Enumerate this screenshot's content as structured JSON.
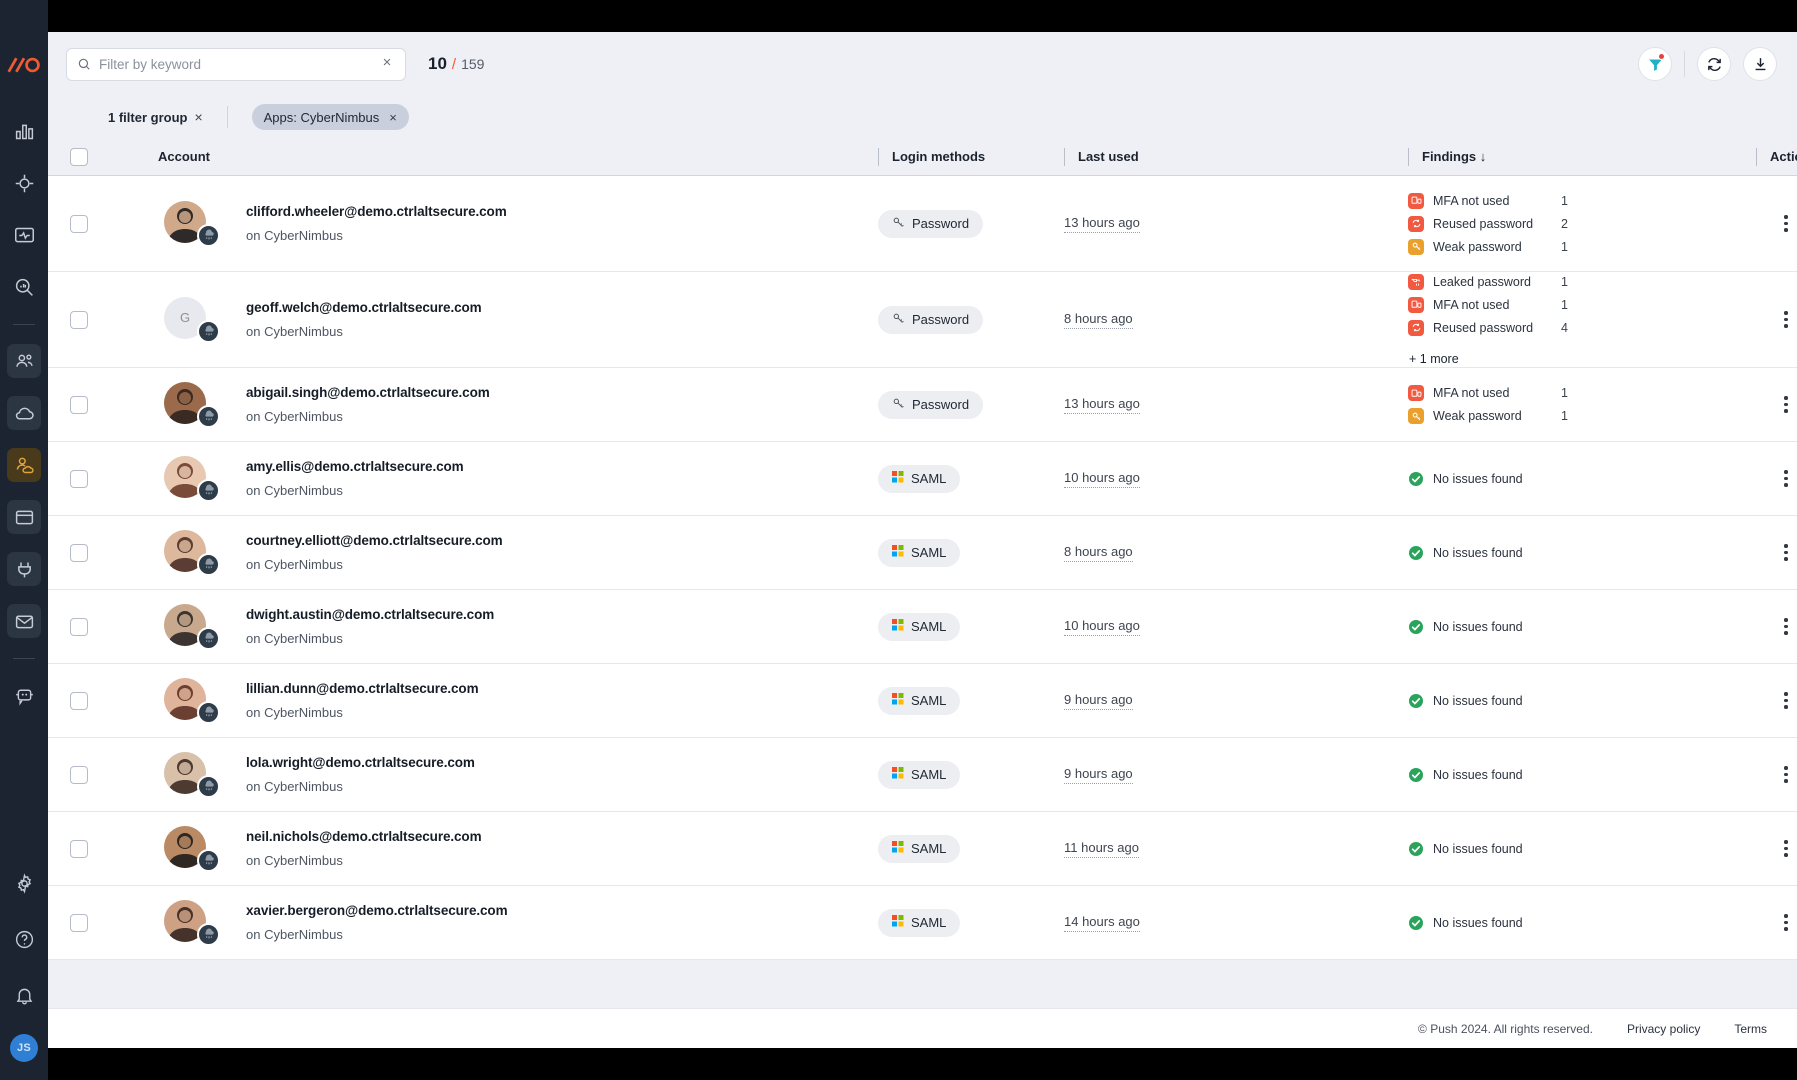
{
  "brand": {
    "logo": "push-logo-icon",
    "accent": "#ef5a33"
  },
  "sidebar": {
    "items": [
      {
        "name": "dashboard",
        "icon": "bar-chart-icon",
        "state": "default"
      },
      {
        "name": "targets",
        "icon": "crosshair-icon",
        "state": "default"
      },
      {
        "name": "activity",
        "icon": "monitor-pulse-icon",
        "state": "default"
      },
      {
        "name": "search",
        "icon": "magnifier-chart-icon",
        "state": "default"
      },
      {
        "name": "identities",
        "icon": "people-icon",
        "state": "active-dark"
      },
      {
        "name": "apps",
        "icon": "cloud-icon",
        "state": "active-dark"
      },
      {
        "name": "accounts",
        "icon": "person-cloud-icon",
        "state": "active-gold"
      },
      {
        "name": "browsers",
        "icon": "window-icon",
        "state": "active-dark"
      },
      {
        "name": "extensions",
        "icon": "plug-icon",
        "state": "active-dark"
      },
      {
        "name": "email",
        "icon": "envelope-icon",
        "state": "active-dark"
      },
      {
        "name": "chatbot",
        "icon": "chat-bot-icon",
        "state": "default"
      }
    ],
    "bottom": [
      {
        "name": "settings",
        "icon": "gear-icon"
      },
      {
        "name": "help",
        "icon": "question-circle-icon"
      },
      {
        "name": "notifications",
        "icon": "bell-icon"
      }
    ],
    "user_initials": "JS"
  },
  "search": {
    "placeholder": "Filter by keyword",
    "value": "",
    "icon": "search-icon",
    "clear_icon": "×"
  },
  "count": {
    "current": "10",
    "separator": "/",
    "total": "159"
  },
  "topbar_actions": [
    {
      "name": "filter-button",
      "icon": "funnel-icon",
      "badge": true
    },
    {
      "name": "refresh-button",
      "icon": "refresh-icon",
      "badge": false
    },
    {
      "name": "download-button",
      "icon": "download-icon",
      "badge": false
    }
  ],
  "filters": {
    "group_label": "1 filter group",
    "group_clear": "×",
    "chips": [
      {
        "label": "Apps: CyberNimbus",
        "clear": "×"
      }
    ]
  },
  "table": {
    "columns": {
      "account": "Account",
      "login_methods": "Login methods",
      "last_used": "Last used",
      "findings": "Findings",
      "findings_sort": "↓",
      "actions": "Actions"
    },
    "rows": [
      {
        "email": "clifford.wheeler@demo.ctrlaltsecure.com",
        "app_line": "on CyberNimbus",
        "avatar": "photo",
        "avatar_initial": "",
        "login_method": "Password",
        "login_icon": "key-icon",
        "last_used": "13 hours ago",
        "no_issues": false,
        "findings": [
          {
            "label": "MFA not used",
            "count": "1",
            "icon": "mfa-icon",
            "color": "#f15a40"
          },
          {
            "label": "Reused password",
            "count": "2",
            "icon": "recycle-icon",
            "color": "#f15a40"
          },
          {
            "label": "Weak password",
            "count": "1",
            "icon": "key-icon",
            "color": "#e9a02c"
          }
        ],
        "more": ""
      },
      {
        "email": "geoff.welch@demo.ctrlaltsecure.com",
        "app_line": "on CyberNimbus",
        "avatar": "initial",
        "avatar_initial": "G",
        "login_method": "Password",
        "login_icon": "key-icon",
        "last_used": "8 hours ago",
        "no_issues": false,
        "findings": [
          {
            "label": "Leaked password",
            "count": "1",
            "icon": "leak-icon",
            "color": "#f15a40"
          },
          {
            "label": "MFA not used",
            "count": "1",
            "icon": "mfa-icon",
            "color": "#f15a40"
          },
          {
            "label": "Reused password",
            "count": "4",
            "icon": "recycle-icon",
            "color": "#f15a40"
          }
        ],
        "more": "+ 1 more"
      },
      {
        "email": "abigail.singh@demo.ctrlaltsecure.com",
        "app_line": "on CyberNimbus",
        "avatar": "photo",
        "avatar_initial": "",
        "login_method": "Password",
        "login_icon": "key-icon",
        "last_used": "13 hours ago",
        "no_issues": false,
        "findings": [
          {
            "label": "MFA not used",
            "count": "1",
            "icon": "mfa-icon",
            "color": "#f15a40"
          },
          {
            "label": "Weak password",
            "count": "1",
            "icon": "key-icon",
            "color": "#e9a02c"
          }
        ],
        "more": ""
      },
      {
        "email": "amy.ellis@demo.ctrlaltsecure.com",
        "app_line": "on CyberNimbus",
        "avatar": "photo",
        "avatar_initial": "",
        "login_method": "SAML",
        "login_icon": "microsoft-icon",
        "last_used": "10 hours ago",
        "no_issues": true,
        "no_issues_label": "No issues found",
        "findings": [],
        "more": ""
      },
      {
        "email": "courtney.elliott@demo.ctrlaltsecure.com",
        "app_line": "on CyberNimbus",
        "avatar": "photo",
        "avatar_initial": "",
        "login_method": "SAML",
        "login_icon": "microsoft-icon",
        "last_used": "8 hours ago",
        "no_issues": true,
        "no_issues_label": "No issues found",
        "findings": [],
        "more": ""
      },
      {
        "email": "dwight.austin@demo.ctrlaltsecure.com",
        "app_line": "on CyberNimbus",
        "avatar": "photo",
        "avatar_initial": "",
        "login_method": "SAML",
        "login_icon": "microsoft-icon",
        "last_used": "10 hours ago",
        "no_issues": true,
        "no_issues_label": "No issues found",
        "findings": [],
        "more": ""
      },
      {
        "email": "lillian.dunn@demo.ctrlaltsecure.com",
        "app_line": "on CyberNimbus",
        "avatar": "photo",
        "avatar_initial": "",
        "login_method": "SAML",
        "login_icon": "microsoft-icon",
        "last_used": "9 hours ago",
        "no_issues": true,
        "no_issues_label": "No issues found",
        "findings": [],
        "more": ""
      },
      {
        "email": "lola.wright@demo.ctrlaltsecure.com",
        "app_line": "on CyberNimbus",
        "avatar": "photo",
        "avatar_initial": "",
        "login_method": "SAML",
        "login_icon": "microsoft-icon",
        "last_used": "9 hours ago",
        "no_issues": true,
        "no_issues_label": "No issues found",
        "findings": [],
        "more": ""
      },
      {
        "email": "neil.nichols@demo.ctrlaltsecure.com",
        "app_line": "on CyberNimbus",
        "avatar": "photo",
        "avatar_initial": "",
        "login_method": "SAML",
        "login_icon": "microsoft-icon",
        "last_used": "11 hours ago",
        "no_issues": true,
        "no_issues_label": "No issues found",
        "findings": [],
        "more": ""
      },
      {
        "email": "xavier.bergeron@demo.ctrlaltsecure.com",
        "app_line": "on CyberNimbus",
        "avatar": "photo",
        "avatar_initial": "",
        "login_method": "SAML",
        "login_icon": "microsoft-icon",
        "last_used": "14 hours ago",
        "no_issues": true,
        "no_issues_label": "No issues found",
        "findings": [],
        "more": ""
      }
    ]
  },
  "footer": {
    "copyright": "© Push 2024. All rights reserved.",
    "privacy": "Privacy policy",
    "terms": "Terms"
  }
}
